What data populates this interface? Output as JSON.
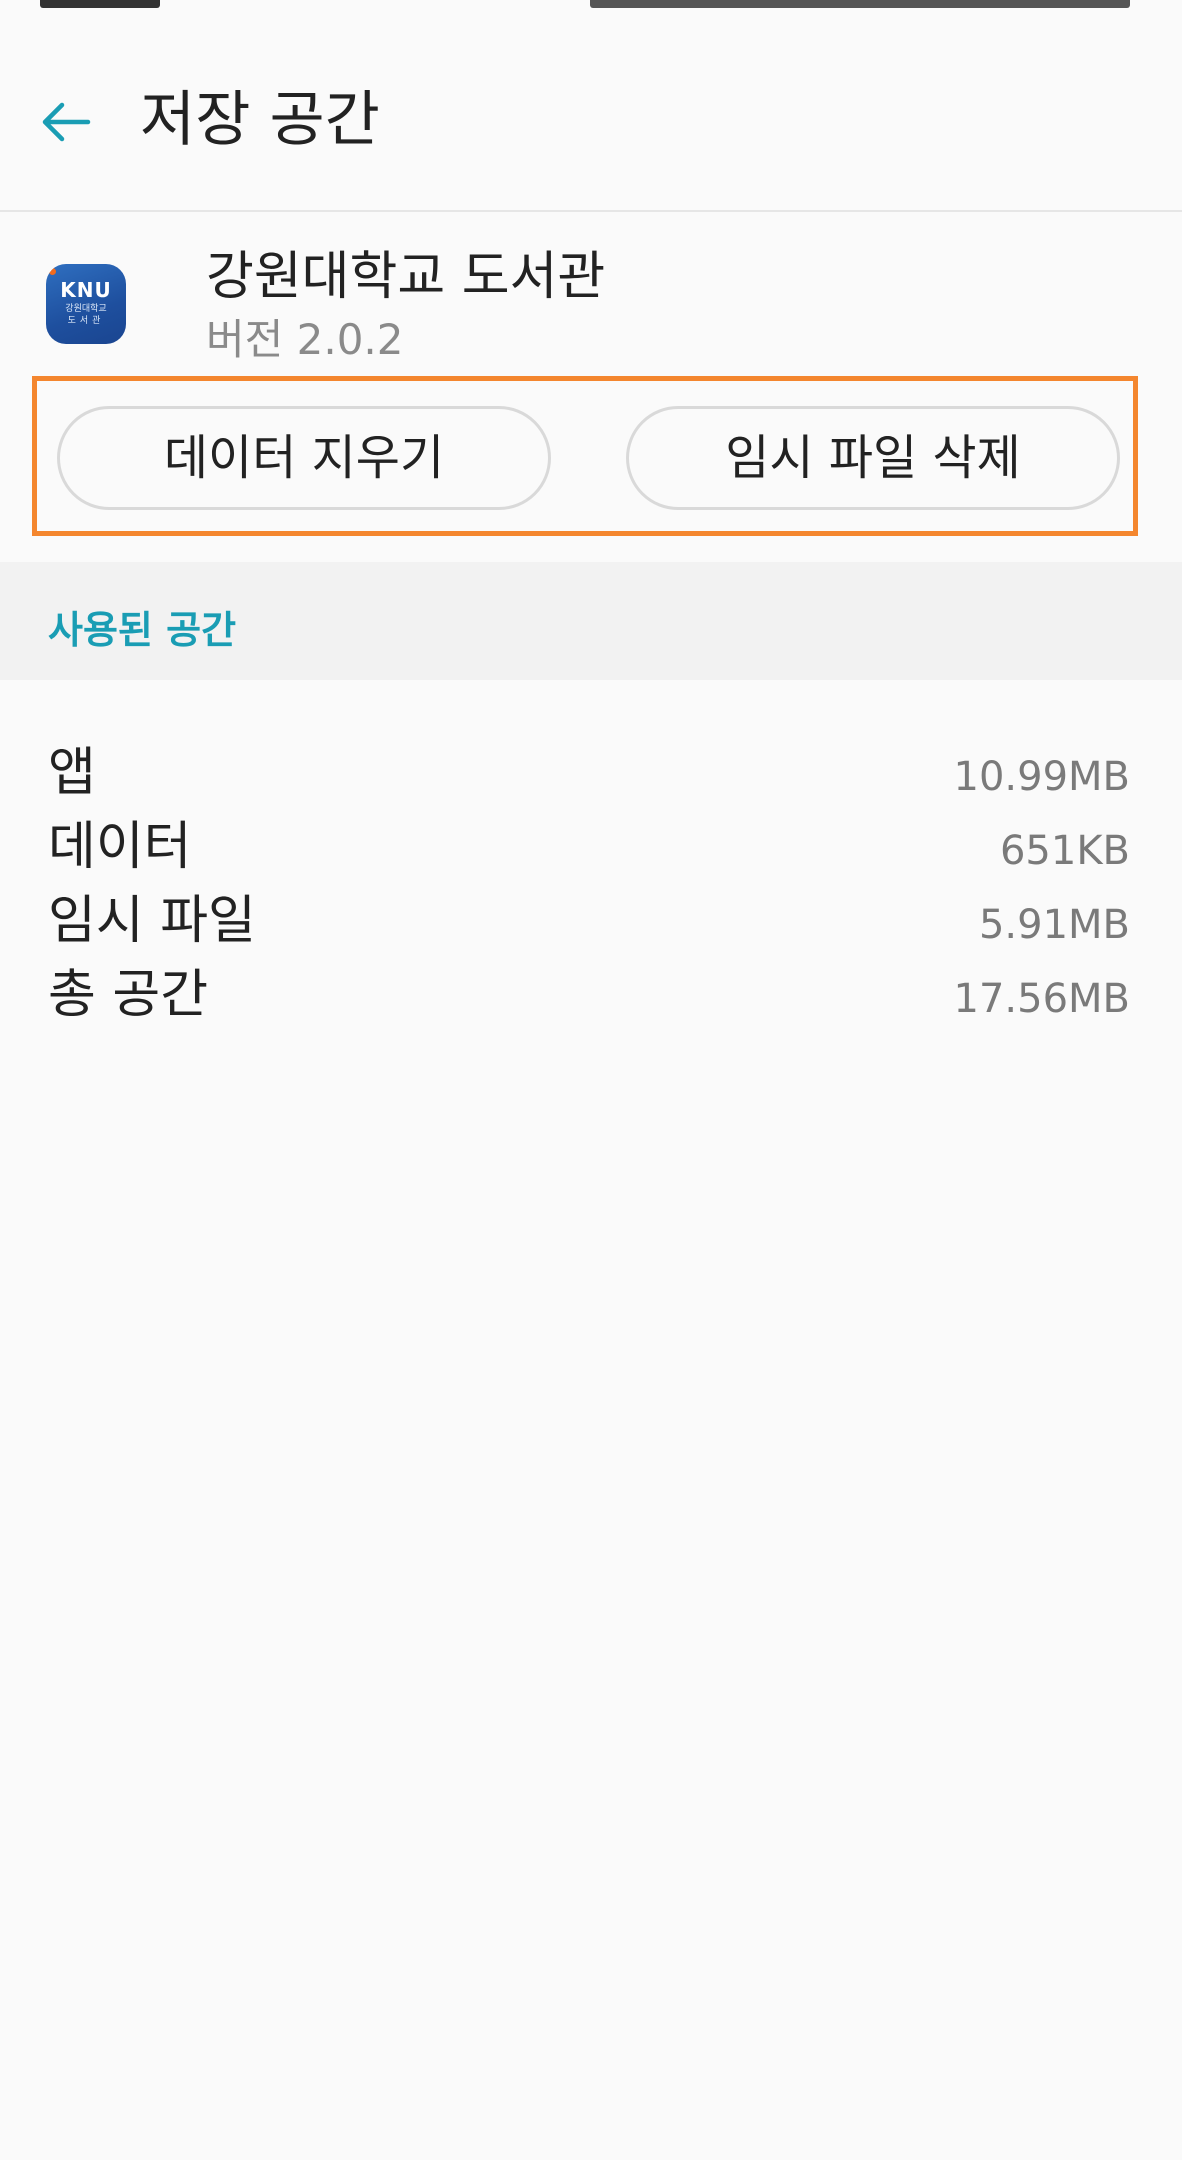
{
  "header": {
    "title": "저장 공간",
    "back_icon": "arrow-left-icon"
  },
  "app": {
    "name": "강원대학교 도서관",
    "version": "버전 2.0.2",
    "icon": {
      "logo_text": "KNU",
      "logo_sub1": "강원대학교",
      "logo_sub2": "도서관",
      "colors": {
        "background": "#1e4f9e",
        "dot": "#f26b1d"
      }
    }
  },
  "actions": {
    "clear_data_label": "데이터 지우기",
    "clear_cache_label": "임시 파일 삭제",
    "highlight_color": "#f4862e"
  },
  "section": {
    "title": "사용된 공간",
    "title_color": "#1a9db4"
  },
  "storage": [
    {
      "label": "앱",
      "value": "10.99MB"
    },
    {
      "label": "데이터",
      "value": "651KB"
    },
    {
      "label": "임시 파일",
      "value": "5.91MB"
    },
    {
      "label": "총 공간",
      "value": "17.56MB"
    }
  ]
}
